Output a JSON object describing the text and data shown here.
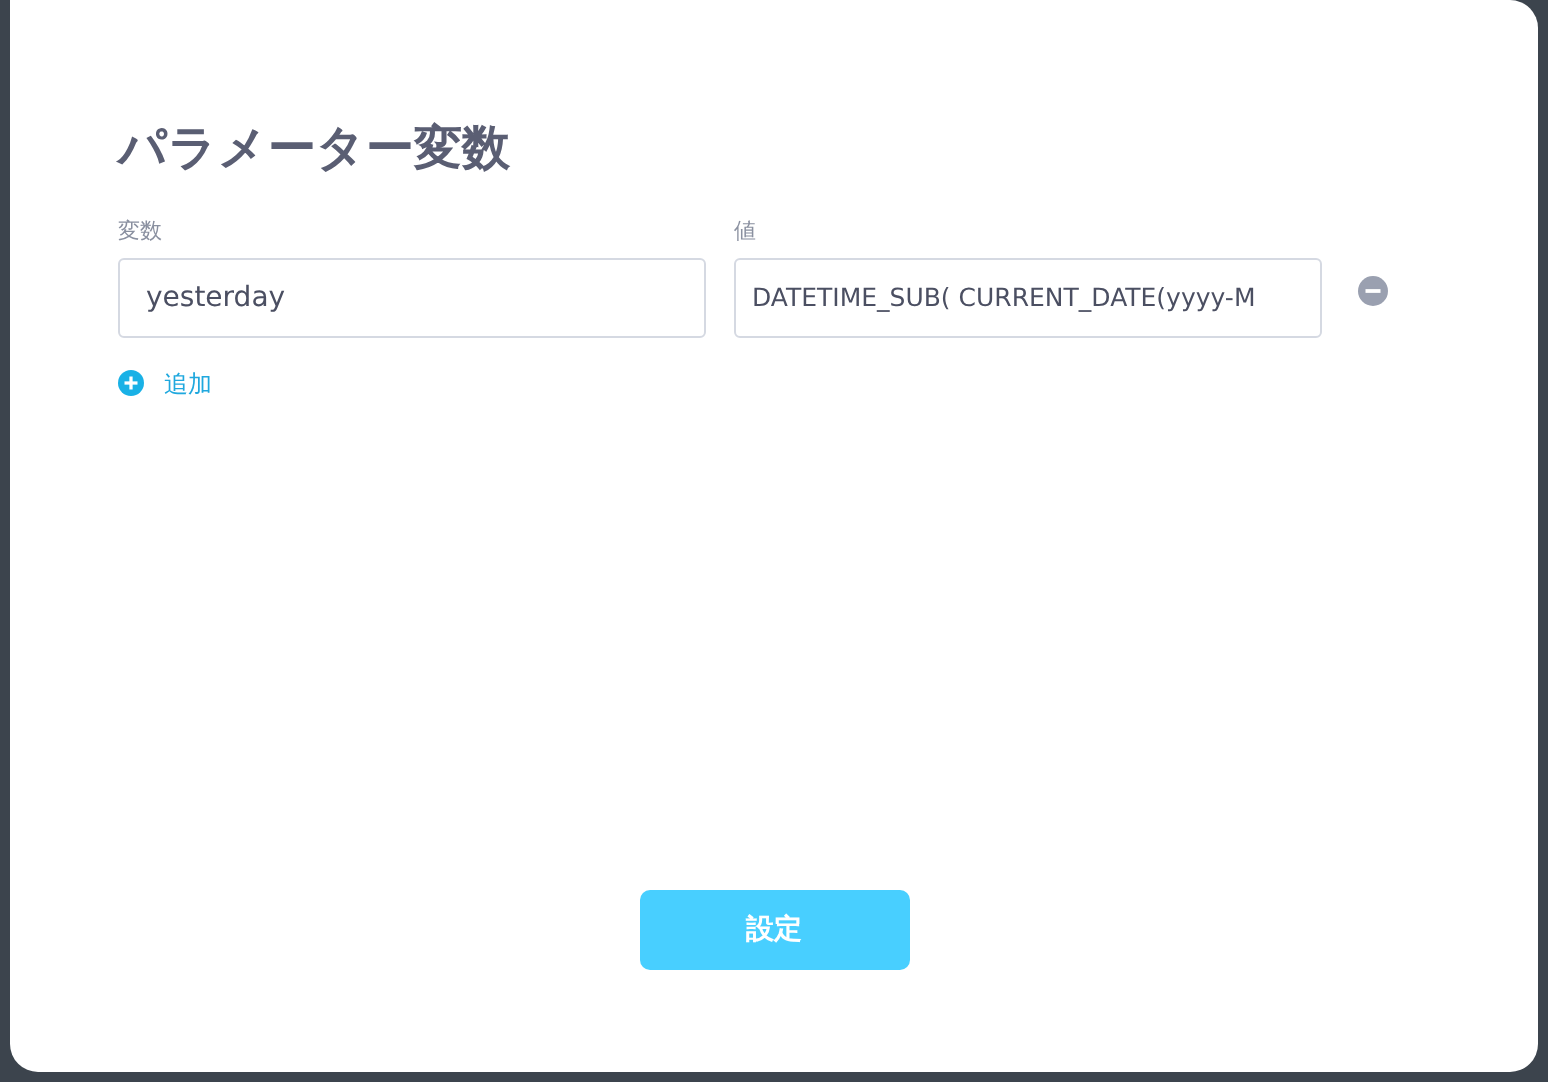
{
  "dialog": {
    "title": "パラメーター変数",
    "columns": [
      "変数",
      "値"
    ],
    "rows": [
      {
        "variable": "yesterday",
        "value": "DATETIME_SUB( CURRENT_DATE(yyyy-M"
      }
    ],
    "add_label": "追加",
    "submit": "設定"
  }
}
